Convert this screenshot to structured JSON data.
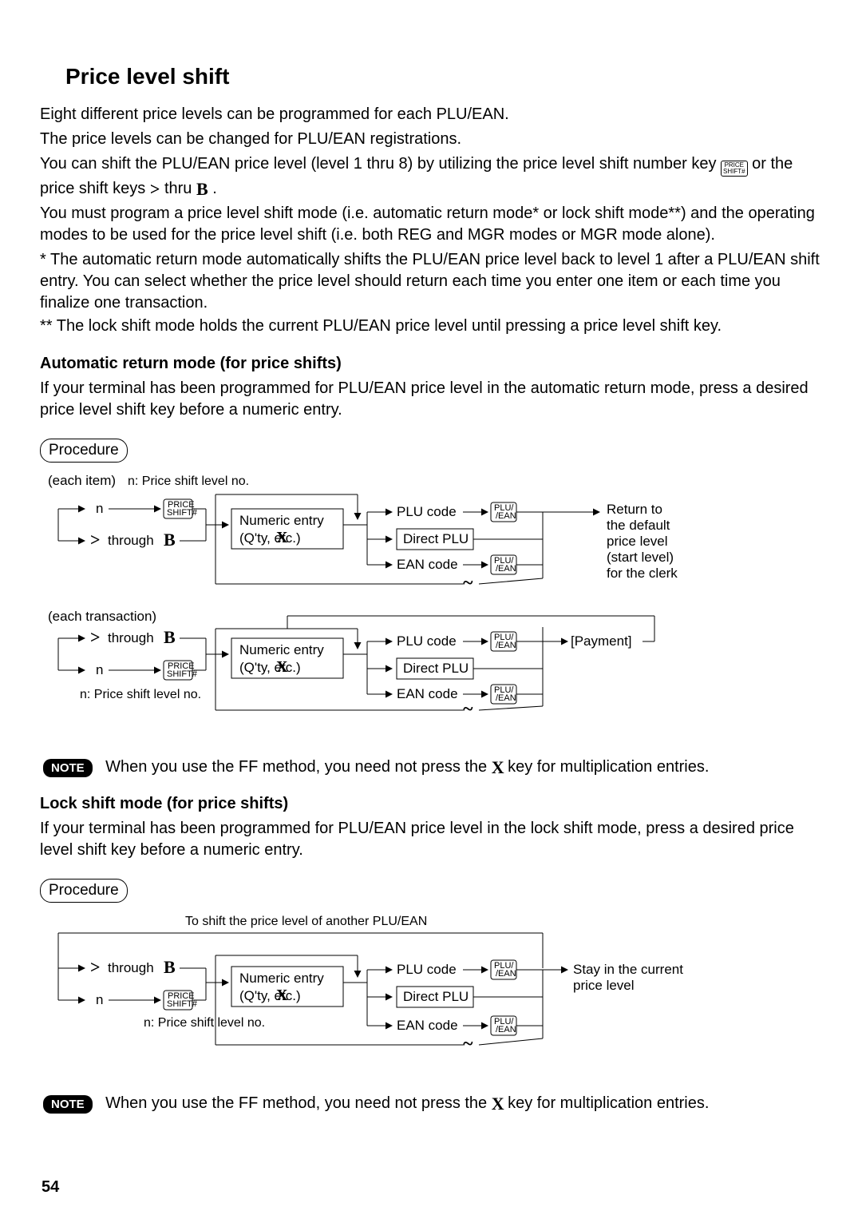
{
  "page_number": "54",
  "title": "Price level shift",
  "intro_1": "Eight different price levels can be programmed for each PLU/EAN.",
  "intro_2": "The price levels can be changed for PLU/EAN registrations.",
  "intro_3a": "You can shift the PLU/EAN price level (level 1 thru 8) by utilizing the price level shift number key ",
  "intro_3b": " or the price shift keys ",
  "intro_3c": " thru ",
  "intro_3d": " .",
  "intro_4": "You must program a price level shift mode (i.e. automatic return mode* or lock shift mode**) and the operating modes to be used for the price level shift (i.e. both REG and MGR modes or MGR mode alone).",
  "star_1a": "* ",
  "star_1b": "The automatic return mode automatically shifts the PLU/EAN price level back to level 1 after a PLU/EAN shift entry.  You can select whether the price level should return each time you enter one item or each time you finalize one transaction.",
  "star_2": "** The lock shift mode holds the current PLU/EAN price level until pressing a price level shift key.",
  "auto_heading": "Automatic return mode (for price shifts)",
  "auto_body": "If your terminal has been programmed for PLU/EAN price level in the automatic return mode, press a desired price level shift key before a numeric entry.",
  "lock_heading": "Lock shift mode (for price shifts)",
  "lock_body": "If your terminal has been programmed for PLU/EAN price level in the lock shift mode, press a desired price level shift key before a numeric entry.",
  "procedure_label": "Procedure",
  "each_item": "(each item)",
  "each_transaction": "(each transaction)",
  "n_caption": "n: Price shift level no.",
  "n_letter": "n",
  "through": "through",
  "numeric_entry": "Numeric entry",
  "qty_etc": "(Q'ty,        etc.)",
  "plu_code": "PLU code",
  "direct_plu": "Direct PLU",
  "ean_code": "EAN code",
  "return_to": "Return to",
  "the_default": "the default",
  "price_level": "price level",
  "start_level": "(start level)",
  "for_the_clerk": "for the clerk",
  "payment": "[Payment]",
  "shift_caption": "To shift the price level of another PLU/EAN",
  "stay_current_1": "Stay in the current",
  "stay_current_2": "price level",
  "note_label": "NOTE",
  "note_text_a": "When you use the FF method,  you need not press the ",
  "note_text_b": " key for multiplication entries.",
  "key_price_shift_top": "PRICE",
  "key_price_shift_bot": "SHIFT#",
  "key_plu_ean_top": "PLU/",
  "key_plu_ean_bot": "/EAN",
  "glyph_gt": ">",
  "glyph_B": "B",
  "glyph_X": "X",
  "glyph_tilde": "~"
}
